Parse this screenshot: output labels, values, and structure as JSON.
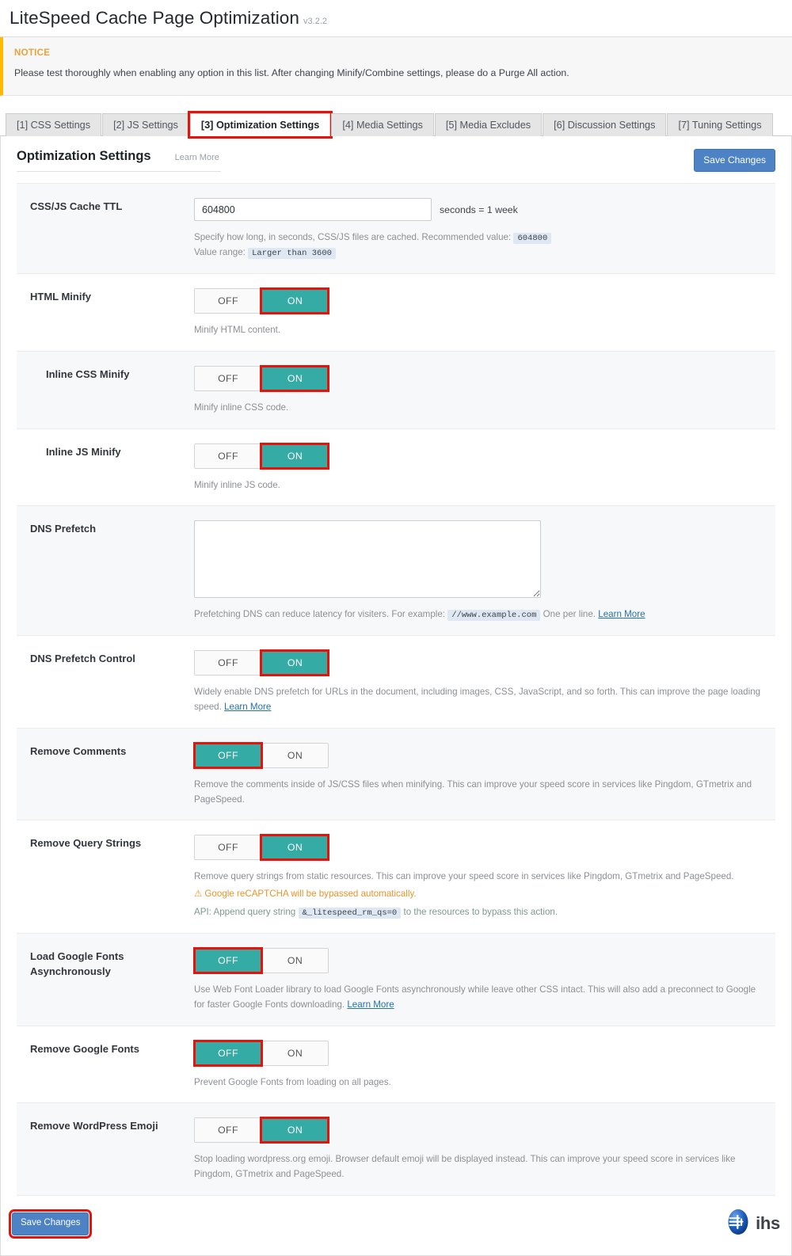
{
  "header": {
    "title": "LiteSpeed Cache Page Optimization",
    "version": "v3.2.2"
  },
  "notice": {
    "label": "NOTICE",
    "text": "Please test thoroughly when enabling any option in this list. After changing Minify/Combine settings, please do a Purge All action."
  },
  "tabs": [
    {
      "label": "[1] CSS Settings",
      "active": false
    },
    {
      "label": "[2] JS Settings",
      "active": false
    },
    {
      "label": "[3] Optimization Settings",
      "active": true
    },
    {
      "label": "[4] Media Settings",
      "active": false
    },
    {
      "label": "[5] Media Excludes",
      "active": false
    },
    {
      "label": "[6] Discussion Settings",
      "active": false
    },
    {
      "label": "[7] Tuning Settings",
      "active": false
    }
  ],
  "card": {
    "title": "Optimization Settings",
    "learn_more": "Learn More",
    "save_label": "Save Changes"
  },
  "footer": {
    "save_label": "Save Changes",
    "brand": "ihs"
  },
  "colors": {
    "toggle_on": "#35aba6",
    "highlight": "#e8120b",
    "button_blue": "#4d82c4",
    "notice_bar": "#ffb900",
    "warning": "#e8952b"
  },
  "settings": {
    "ttl": {
      "label": "CSS/JS Cache TTL",
      "value": "604800",
      "unit": "seconds = 1 week",
      "desc_prefix": "Specify how long, in seconds, CSS/JS files are cached. Recommended value:",
      "desc_code": "604800",
      "range_prefix": "Value range:",
      "range_code": "Larger than 3600"
    },
    "html_minify": {
      "label": "HTML Minify",
      "off": "OFF",
      "on": "ON",
      "state": "ON",
      "desc": "Minify HTML content."
    },
    "inline_css_minify": {
      "label": "Inline CSS Minify",
      "off": "OFF",
      "on": "ON",
      "state": "ON",
      "desc": "Minify inline CSS code."
    },
    "inline_js_minify": {
      "label": "Inline JS Minify",
      "off": "OFF",
      "on": "ON",
      "state": "ON",
      "desc": "Minify inline JS code."
    },
    "dns_prefetch": {
      "label": "DNS Prefetch",
      "value": "",
      "desc_prefix": "Prefetching DNS can reduce latency for visiters. For example:",
      "desc_code": "//www.example.com",
      "desc_suffix": "One per line.",
      "learn_more": "Learn More"
    },
    "dns_prefetch_control": {
      "label": "DNS Prefetch Control",
      "off": "OFF",
      "on": "ON",
      "state": "ON",
      "desc": "Widely enable DNS prefetch for URLs in the document, including images, CSS, JavaScript, and so forth. This can improve the page loading speed.",
      "learn_more": "Learn More"
    },
    "remove_comments": {
      "label": "Remove Comments",
      "off": "OFF",
      "on": "ON",
      "state": "OFF",
      "desc": "Remove the comments inside of JS/CSS files when minifying. This can improve your speed score in services like Pingdom, GTmetrix and PageSpeed."
    },
    "remove_query_strings": {
      "label": "Remove Query Strings",
      "off": "OFF",
      "on": "ON",
      "state": "ON",
      "desc": "Remove query strings from static resources. This can improve your speed score in services like Pingdom, GTmetrix and PageSpeed.",
      "warning": "Google reCAPTCHA will be bypassed automatically.",
      "api_prefix": "API: Append query string",
      "api_code": "&_litespeed_rm_qs=0",
      "api_suffix": "to the resources to bypass this action."
    },
    "load_google_fonts_async": {
      "label": "Load Google Fonts Asynchronously",
      "off": "OFF",
      "on": "ON",
      "state": "OFF",
      "desc": "Use Web Font Loader library to load Google Fonts asynchronously while leave other CSS intact. This will also add a preconnect to Google for faster Google Fonts downloading.",
      "learn_more": "Learn More"
    },
    "remove_google_fonts": {
      "label": "Remove Google Fonts",
      "off": "OFF",
      "on": "ON",
      "state": "OFF",
      "desc": "Prevent Google Fonts from loading on all pages."
    },
    "remove_wordpress_emoji": {
      "label": "Remove WordPress Emoji",
      "off": "OFF",
      "on": "ON",
      "state": "ON",
      "desc": "Stop loading wordpress.org emoji. Browser default emoji will be displayed instead. This can improve your speed score in services like Pingdom, GTmetrix and PageSpeed."
    }
  }
}
